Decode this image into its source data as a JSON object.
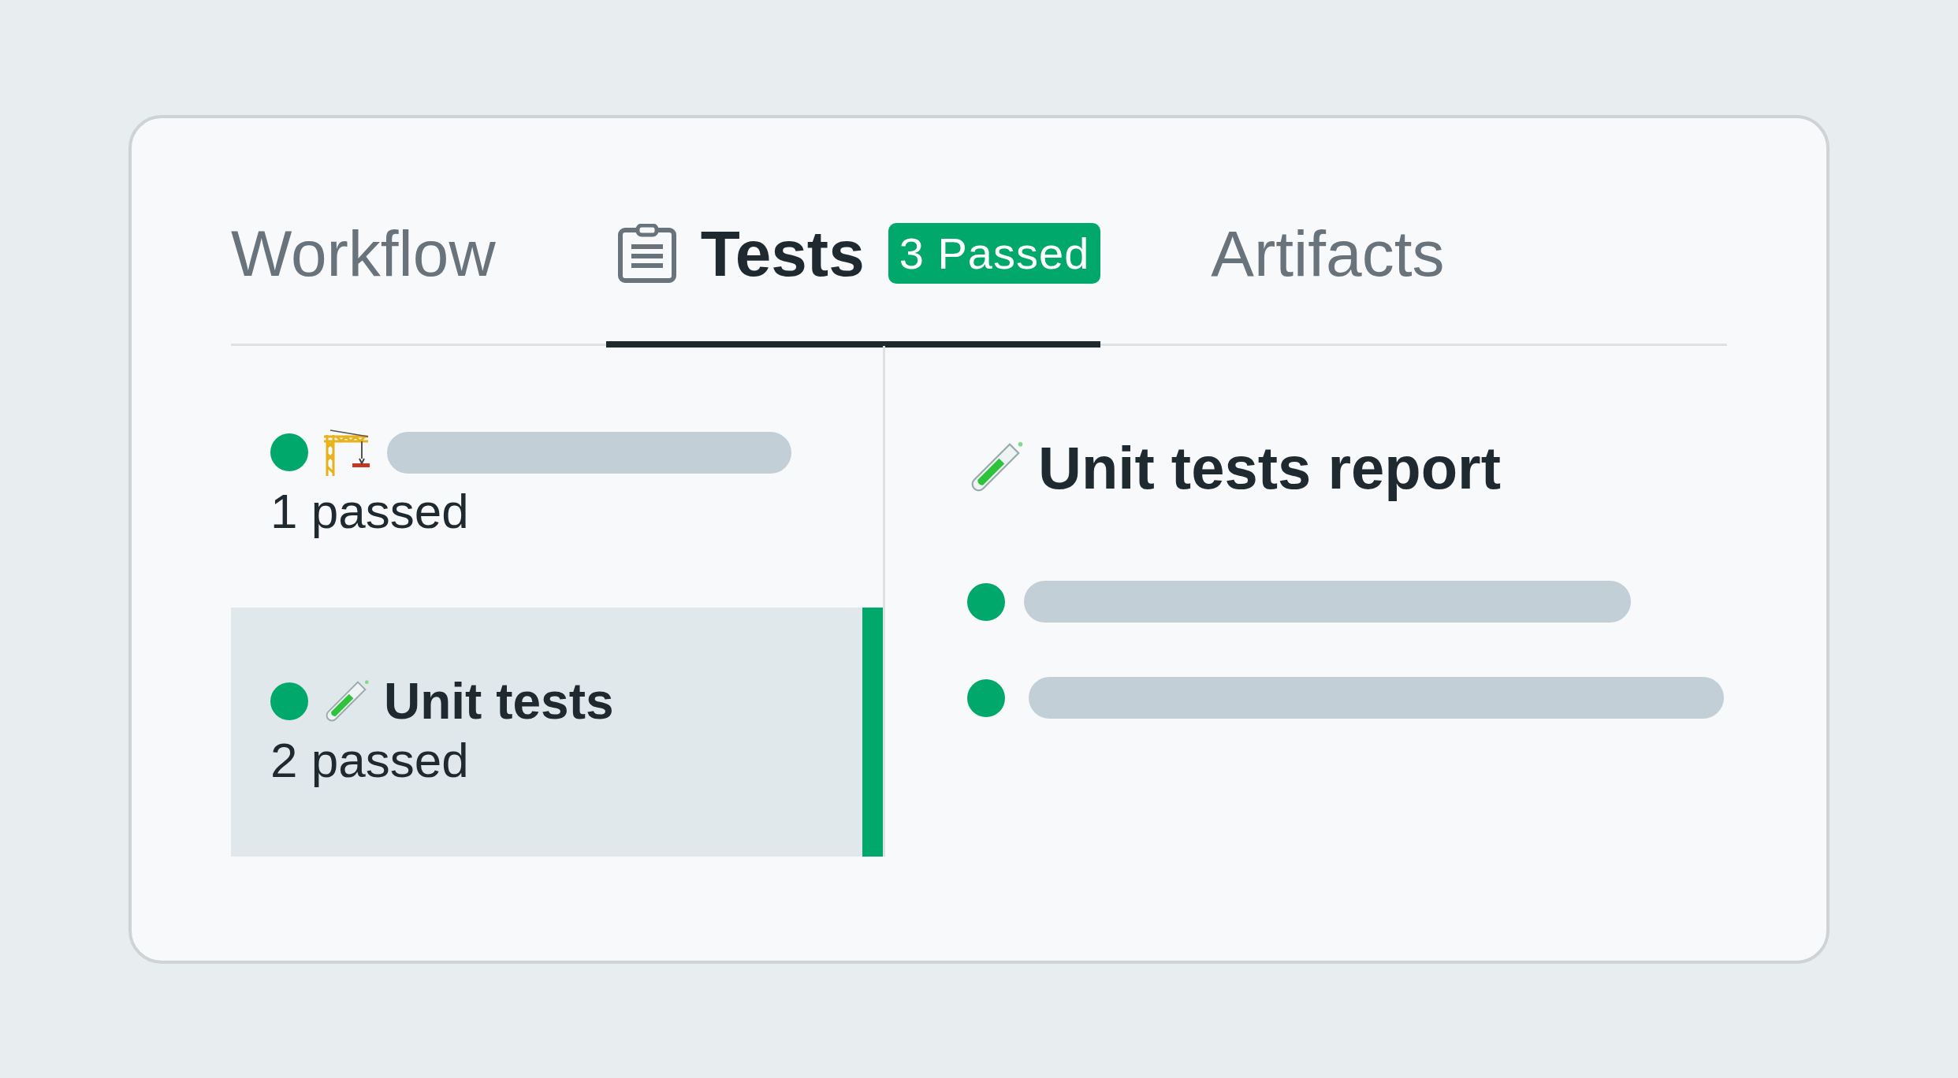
{
  "tabs": [
    {
      "label": "Workflow",
      "selected": false
    },
    {
      "label": "Tests",
      "selected": true,
      "badge": "3 Passed"
    },
    {
      "label": "Artifacts",
      "selected": false
    }
  ],
  "suites": [
    {
      "color": "#00a86b",
      "selected": false,
      "summary": "1 passed"
    },
    {
      "color": "#00a86b",
      "selected": true,
      "title": "Unit tests",
      "summary": "2 passed"
    }
  ],
  "report": {
    "title": "Unit tests report",
    "results": [
      {
        "color": "#00a86b"
      },
      {
        "color": "#00a86b"
      }
    ]
  }
}
